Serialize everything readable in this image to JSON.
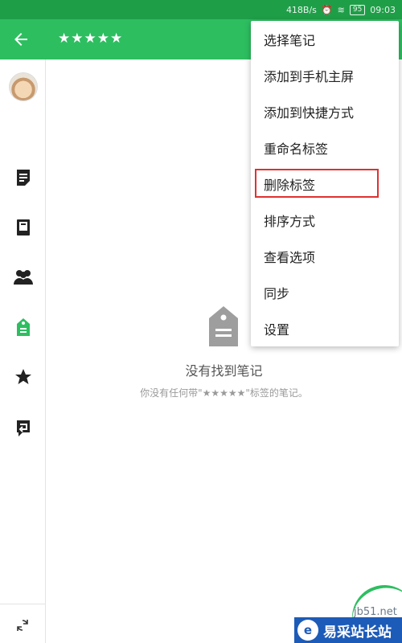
{
  "status_bar": {
    "network_speed": "418B/s",
    "battery": "95",
    "time": "09:03"
  },
  "toolbar": {
    "title": "★★★★★"
  },
  "sidebar": {
    "items": [
      {
        "icon": "note-icon"
      },
      {
        "icon": "notebook-icon"
      },
      {
        "icon": "people-icon"
      },
      {
        "icon": "tag-icon",
        "active": true
      },
      {
        "icon": "star-icon"
      },
      {
        "icon": "workchat-icon"
      }
    ],
    "sync_icon": "sync-icon"
  },
  "empty_state": {
    "title": "没有找到笔记",
    "description": "你没有任何带\"★★★★★\"标签的笔记。"
  },
  "menu": {
    "items": [
      "选择笔记",
      "添加到手机主屏",
      "添加到快捷方式",
      "重命名标签",
      "删除标签",
      "排序方式",
      "查看选项",
      "同步",
      "设置"
    ],
    "highlighted_index": 4
  },
  "watermark": {
    "site": "jb51.net",
    "name": "易采站长站"
  },
  "colors": {
    "brand_green": "#2dbe60",
    "status_green": "#1f9e48",
    "highlight_red": "#e0312f"
  }
}
